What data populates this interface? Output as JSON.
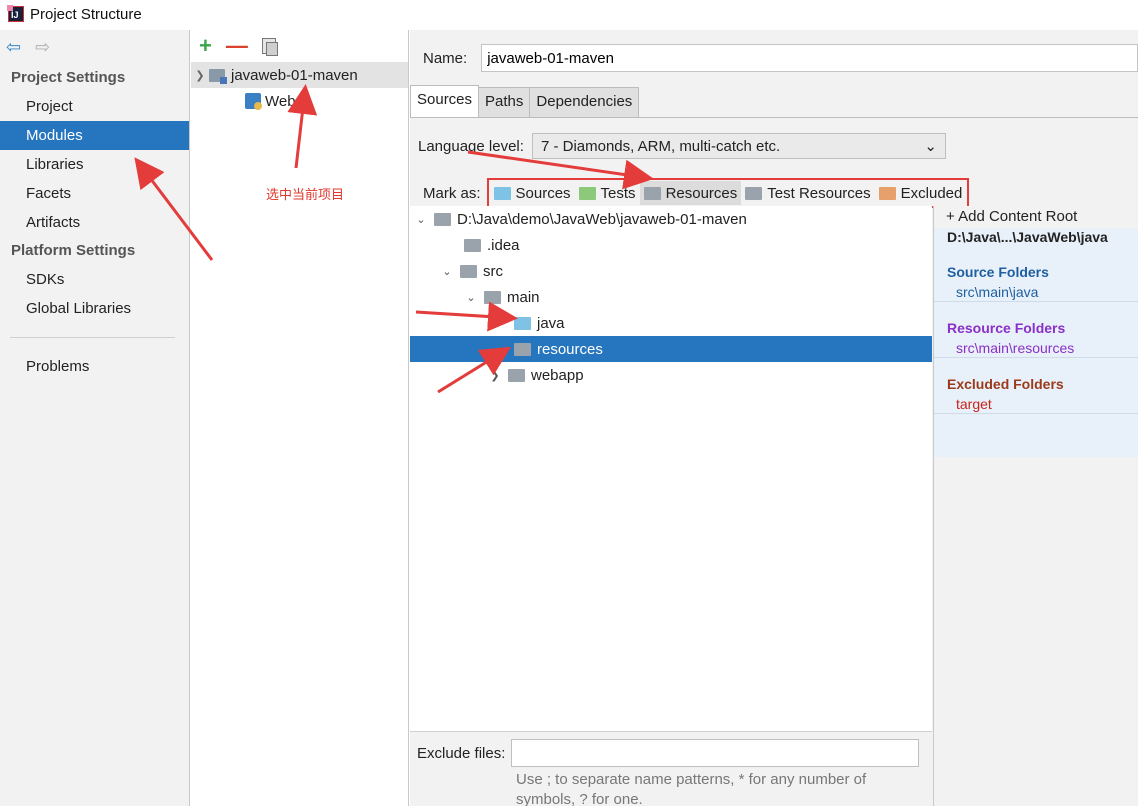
{
  "window": {
    "title": "Project Structure"
  },
  "nav": {
    "project_settings_heading": "Project Settings",
    "project_settings": [
      "Project",
      "Modules",
      "Libraries",
      "Facets",
      "Artifacts"
    ],
    "selected": "Modules",
    "platform_settings_heading": "Platform Settings",
    "platform_settings": [
      "SDKs",
      "Global Libraries"
    ],
    "problems": "Problems"
  },
  "modules": {
    "root": "javaweb-01-maven",
    "child": "Web",
    "annotation": "选中当前项目"
  },
  "content": {
    "name_label": "Name:",
    "name_value": "javaweb-01-maven",
    "tabs": [
      "Sources",
      "Paths",
      "Dependencies"
    ],
    "active_tab": "Sources",
    "language_level_label": "Language level:",
    "language_level_value": "7 - Diamonds, ARM, multi-catch etc.",
    "mark_as_label": "Mark as:",
    "mark_as": [
      {
        "label": "Sources",
        "color": "#7ec3e6"
      },
      {
        "label": "Tests",
        "color": "#8cc97a"
      },
      {
        "label": "Resources",
        "color": "#9aa3ab"
      },
      {
        "label": "Test Resources",
        "color": "#9aa3ab"
      },
      {
        "label": "Excluded",
        "color": "#e8a06a"
      }
    ]
  },
  "tree": {
    "root": "D:\\Java\\demo\\JavaWeb\\javaweb-01-maven",
    "idea": ".idea",
    "src": "src",
    "main": "main",
    "java": "java",
    "resources": "resources",
    "webapp": "webapp"
  },
  "exclude": {
    "label": "Exclude files:",
    "hint_line1": "Use ; to separate name patterns, * for any number of",
    "hint_line2": "symbols, ? for one."
  },
  "roots": {
    "add_label": "+ Add Content Root",
    "path": "D:\\Java\\...\\JavaWeb\\java",
    "source_heading": "Source Folders",
    "source_value": "src\\main\\java",
    "source_color": "#1f5fa0",
    "resource_heading": "Resource Folders",
    "resource_value": "src\\main\\resources",
    "resource_color": "#8a2fc7",
    "excluded_heading": "Excluded Folders",
    "excluded_value": "target",
    "excluded_color": "#9b3a1a"
  }
}
